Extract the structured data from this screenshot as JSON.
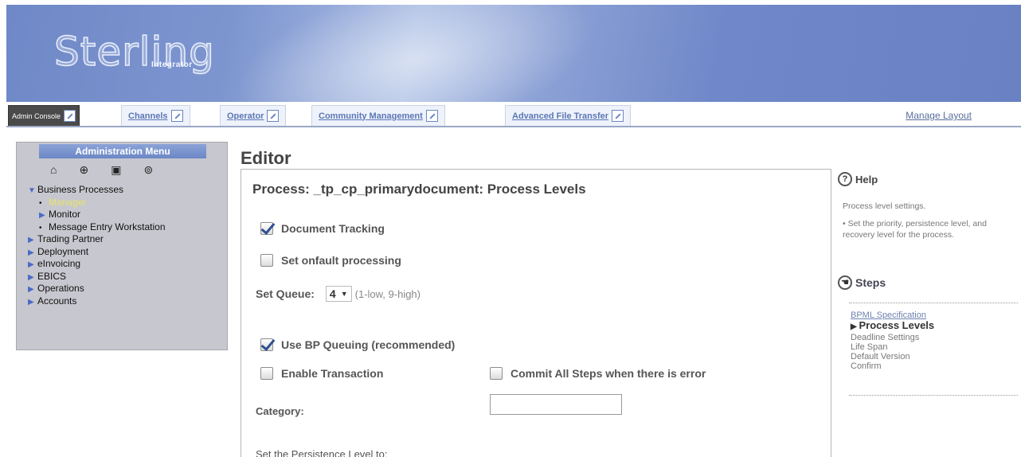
{
  "banner": {
    "logo_main": "Sterling",
    "logo_sub": "Integrator"
  },
  "nav": {
    "tabs": [
      {
        "label": "Admin Console",
        "active": true
      },
      {
        "label": "Channels",
        "active": false
      },
      {
        "label": "Operator",
        "active": false
      },
      {
        "label": "Community Management",
        "active": false
      },
      {
        "label": "Advanced File Transfer",
        "active": false
      }
    ],
    "manage_layout": "Manage Layout"
  },
  "sidebar": {
    "title": "Administration Menu",
    "icons": [
      "home-icon",
      "globe-icon",
      "lock-icon",
      "help-icon"
    ],
    "items": [
      {
        "label": "Business Processes",
        "marker": "▼"
      },
      {
        "label": "Manager",
        "marker": "•",
        "sub": true,
        "current": true
      },
      {
        "label": "Monitor",
        "marker": "▶",
        "sub": true
      },
      {
        "label": "Message Entry Workstation",
        "marker": "•",
        "sub": true
      },
      {
        "label": "Trading Partner",
        "marker": "▶"
      },
      {
        "label": "Deployment",
        "marker": "▶"
      },
      {
        "label": "eInvoicing",
        "marker": "▶"
      },
      {
        "label": "EBICS",
        "marker": "▶"
      },
      {
        "label": "Operations",
        "marker": "▶"
      },
      {
        "label": "Accounts",
        "marker": "▶"
      }
    ]
  },
  "editor": {
    "title": "Editor",
    "process_title": "Process: _tp_cp_primarydocument: Process Levels",
    "document_tracking": "Document Tracking",
    "onfault": "Set onfault processing",
    "set_queue_label": "Set Queue:",
    "queue_value": "4",
    "queue_hint": "(1-low, 9-high)",
    "use_bp_queuing": "Use BP Queuing (recommended)",
    "enable_transaction": "Enable Transaction",
    "commit_all_steps": "Commit All Steps when there is error",
    "category_label": "Category:",
    "category_value": "",
    "persistence_label": "Set the Persistence Level to:"
  },
  "help": {
    "title": "Help",
    "line1": "Process level settings.",
    "bullet": "• Set the priority, persistence level, and recovery level for the process.",
    "steps_title": "Steps",
    "steps": [
      {
        "label": "BPML Specification",
        "type": "link"
      },
      {
        "label": "Process Levels",
        "type": "current"
      },
      {
        "label": "Deadline Settings",
        "type": "plain"
      },
      {
        "label": "Life Span",
        "type": "plain"
      },
      {
        "label": "Default Version",
        "type": "plain"
      },
      {
        "label": "Confirm",
        "type": "plain"
      }
    ]
  }
}
